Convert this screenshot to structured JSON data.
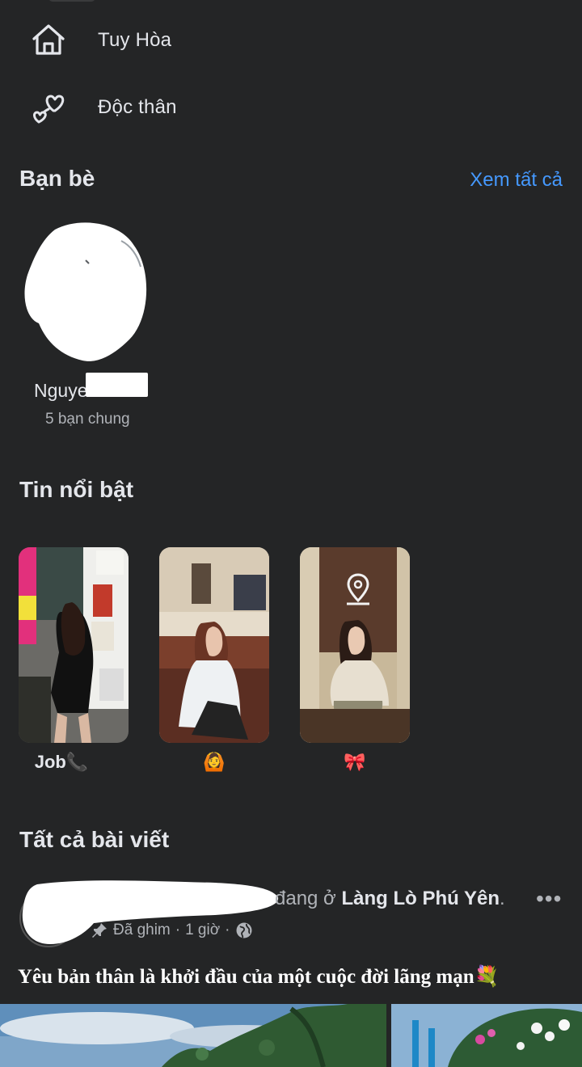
{
  "intro": {
    "items": [
      {
        "icon": "home-icon",
        "text": "Tuy Hòa"
      },
      {
        "icon": "hearts-icon",
        "text": "Độc thân"
      }
    ]
  },
  "friends": {
    "title": "Bạn bè",
    "see_all": "Xem tất cả",
    "list": [
      {
        "name": "Nguyen Thi",
        "mutual": "5 bạn chung"
      }
    ]
  },
  "highlights": {
    "title": "Tin nổi bật",
    "items": [
      {
        "label": "Job📞"
      },
      {
        "label": "🙆"
      },
      {
        "label": "🎀"
      }
    ]
  },
  "posts": {
    "title": "Tất cả bài viết",
    "items": [
      {
        "header_prefix": "đang ở",
        "place": "Làng Lò Phú Yên",
        "pinned": "Đã ghim",
        "time": "1 giờ",
        "separator": "·",
        "more": "•••",
        "text": "Yêu bản thân là khởi đầu của một cuộc đời lãng mạn💐"
      }
    ]
  },
  "colors": {
    "background": "#242526",
    "link": "#4599ff",
    "secondary_text": "#b0b3b8"
  }
}
